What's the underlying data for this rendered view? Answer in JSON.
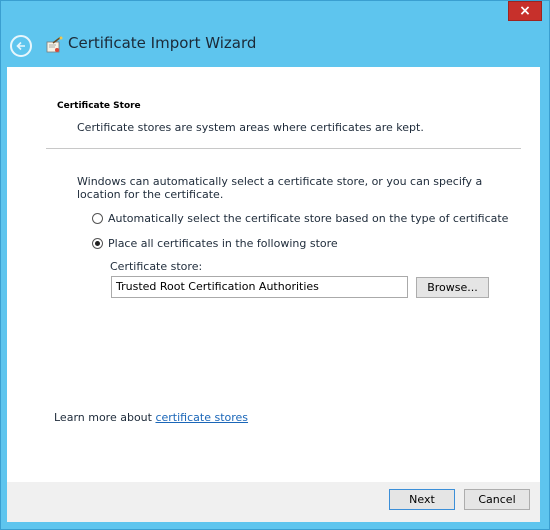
{
  "window": {
    "title": "Certificate Import Wizard",
    "close_glyph": "×",
    "accent_color": "#5ec5ee"
  },
  "section": {
    "title": "Certificate Store",
    "description": "Certificate stores are system areas where certificates are kept."
  },
  "intro": "Windows can automatically select a certificate store, or you can specify a location for the certificate.",
  "options": [
    {
      "label": "Automatically select the certificate store based on the type of certificate",
      "selected": false
    },
    {
      "label": "Place all certificates in the following store",
      "selected": true
    }
  ],
  "store": {
    "label": "Certificate store:",
    "value": "Trusted Root Certification Authorities",
    "browse_label": "Browse..."
  },
  "learn_more": {
    "prefix": "Learn more about ",
    "link_text": "certificate stores"
  },
  "footer": {
    "next_label": "Next",
    "cancel_label": "Cancel"
  },
  "icons": [
    "back-arrow-icon",
    "certificate-wizard-icon",
    "close-icon"
  ]
}
